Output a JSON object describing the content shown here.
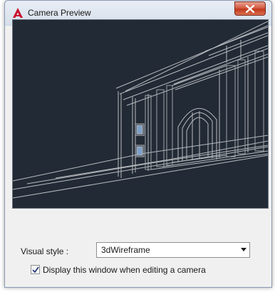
{
  "window": {
    "title": "Camera Preview",
    "icon": "autocad-logo-icon",
    "close_icon": "close-x-icon",
    "accent_close": "#c2391c"
  },
  "preview": {
    "background": "#222a35",
    "content": "3d-wireframe-building"
  },
  "controls": {
    "visual_style_label": "Visual style :",
    "visual_style_value": "3dWireframe",
    "dropdown_icon": "chevron-down-icon",
    "display_checkbox_label": "Display this window when editing a camera",
    "display_checkbox_checked": true
  }
}
